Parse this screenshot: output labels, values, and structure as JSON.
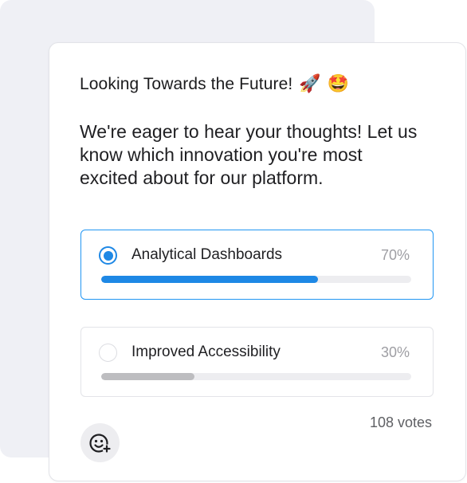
{
  "poll": {
    "title": "Looking Towards the Future!",
    "title_emojis": [
      "🚀",
      "🤩"
    ],
    "question": "We're eager to hear your thoughts! Let us know which innovation you're most excited about for our platform.",
    "options": [
      {
        "label": "Analytical Dashboards",
        "percent_label": "70%",
        "percent": 70,
        "selected": true
      },
      {
        "label": "Improved Accessibility",
        "percent_label": "30%",
        "percent": 30,
        "selected": false
      }
    ],
    "votes_label": "108 votes"
  },
  "reaction": {
    "icon": "add-reaction-icon"
  },
  "colors": {
    "accent": "#1e88e5",
    "unselected_bar": "#bdbdc0",
    "track": "#ededf0",
    "backdrop": "#eff0f5"
  }
}
